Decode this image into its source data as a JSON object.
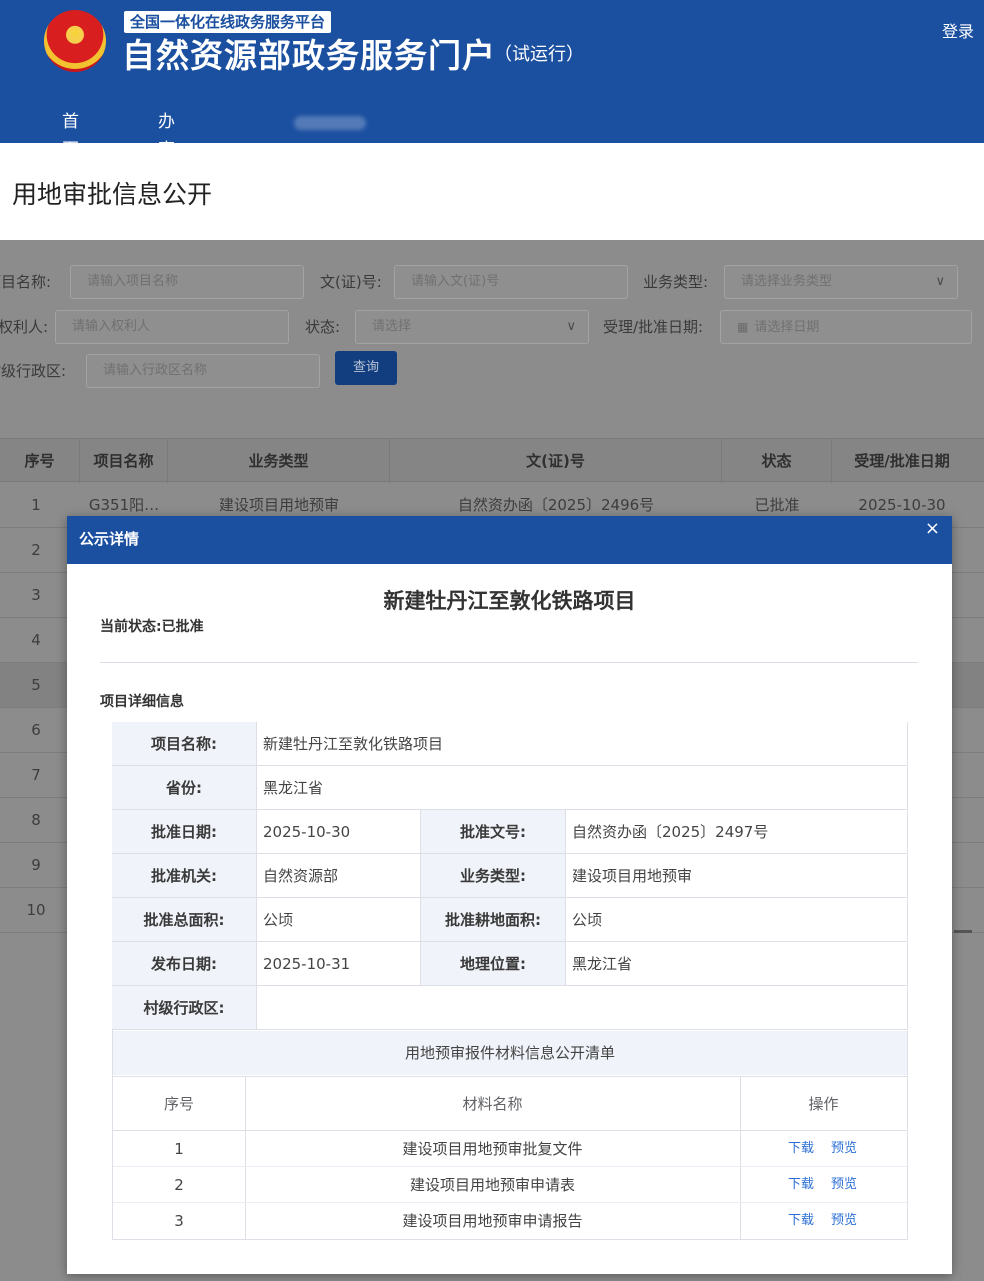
{
  "header": {
    "platform_tag": "全国一体化在线政务服务平台",
    "title": "自然资源部政务服务门户",
    "subtitle": "（试运行）",
    "login": "登录",
    "nav": [
      "首页",
      "办事事项"
    ]
  },
  "page_title": "用地审批信息公开",
  "search": {
    "project_name_label": "项目名称:",
    "project_name_placeholder": "请输入项目名称",
    "doc_no_label": "文(证)号:",
    "doc_no_placeholder": "请输入文(证)号",
    "biz_type_label": "业务类型:",
    "biz_type_placeholder": "请选择业务类型",
    "owner_label": "权利人:",
    "owner_placeholder": "请输入权利人",
    "status_label": "状态:",
    "status_placeholder": "请选择",
    "date_label": "受理/批准日期:",
    "date_placeholder": "请选择日期",
    "village_label": "村级行政区:",
    "village_placeholder": "请输入行政区名称",
    "query_button": "查询"
  },
  "results_table": {
    "columns": [
      "序号",
      "项目名称",
      "业务类型",
      "文(证)号",
      "状态",
      "受理/批准日期"
    ],
    "first_row": [
      "1",
      "G351阳…",
      "建设项目用地预审",
      "自然资办函〔2025〕2496号",
      "已批准",
      "2025-10-30"
    ],
    "row_numbers": [
      "2",
      "3",
      "4",
      "5",
      "6",
      "7",
      "8",
      "9",
      "10"
    ]
  },
  "modal": {
    "title": "公示详情",
    "close": "×",
    "project_title": "新建牡丹江至敦化铁路项目",
    "status_line": "当前状态:已批准",
    "section_title": "项目详细信息",
    "details": {
      "project_name_label": "项目名称:",
      "project_name": "新建牡丹江至敦化铁路项目",
      "province_label": "省份:",
      "province": "黑龙江省",
      "approval_date_label": "批准日期:",
      "approval_date": "2025-10-30",
      "approval_no_label": "批准文号:",
      "approval_no": "自然资办函〔2025〕2497号",
      "authority_label": "批准机关:",
      "authority": "自然资源部",
      "biz_type_label": "业务类型:",
      "biz_type": "建设项目用地预审",
      "total_area_label": "批准总面积:",
      "total_area": "公顷",
      "farmland_area_label": "批准耕地面积:",
      "farmland_area": "公顷",
      "publish_date_label": "发布日期:",
      "publish_date": "2025-10-31",
      "location_label": "地理位置:",
      "location": "黑龙江省",
      "village_label": "村级行政区:",
      "village": ""
    },
    "materials": {
      "title": "用地预审报件材料信息公开清单",
      "columns": [
        "序号",
        "材料名称",
        "操作"
      ],
      "rows": [
        {
          "no": "1",
          "name": "建设项目用地预审批复文件",
          "download": "下载",
          "preview": "预览"
        },
        {
          "no": "2",
          "name": "建设项目用地预审申请表",
          "download": "下载",
          "preview": "预览"
        },
        {
          "no": "3",
          "name": "建设项目用地预审申请报告",
          "download": "下载",
          "preview": "预览"
        }
      ]
    }
  }
}
